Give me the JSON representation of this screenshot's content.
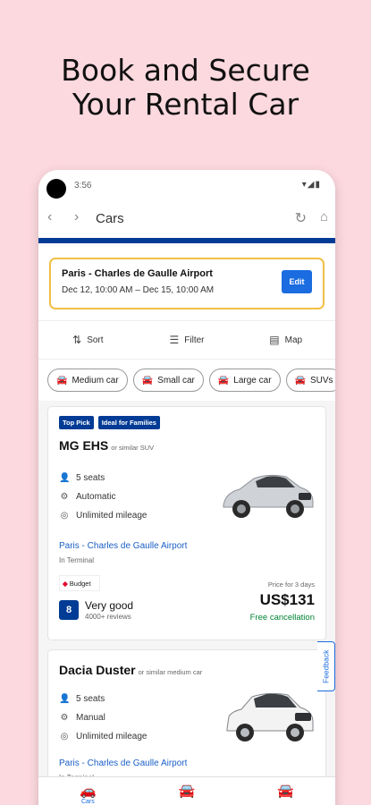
{
  "headline": {
    "line1": "Book and Secure",
    "line2": "Your Rental Car"
  },
  "status_bar": {
    "time": "3:56",
    "icons": "▾◢▮"
  },
  "nav": {
    "back": "‹",
    "forward": "›",
    "title": "Cars",
    "reload": "↻",
    "home": "⌂"
  },
  "search": {
    "location": "Paris - Charles de Gaulle Airport",
    "dates": "Dec 12, 10:00 AM   –   Dec 15, 10:00 AM",
    "edit_label": "Edit"
  },
  "toolbar": {
    "sort": "Sort",
    "filter": "Filter",
    "map": "Map"
  },
  "chips": [
    "Medium car",
    "Small car",
    "Large car",
    "SUVs"
  ],
  "cars": [
    {
      "badges": [
        "Top Pick",
        "Ideal for Families"
      ],
      "name": "MG EHS",
      "similar": "or similar SUV",
      "specs": [
        "5 seats",
        "Automatic",
        "Unlimited mileage"
      ],
      "pickup": "Paris - Charles de Gaulle Airport",
      "terminal": "In Terminal",
      "supplier": "Budget",
      "score": "8",
      "rating_label": "Very good",
      "reviews": "4000+ reviews",
      "price_for": "Price for 3 days",
      "price": "US$131",
      "free_cancel": "Free cancellation"
    },
    {
      "name": "Dacia Duster",
      "similar": "or similar medium car",
      "specs": [
        "5 seats",
        "Manual",
        "Unlimited mileage"
      ],
      "pickup": "Paris - Charles de Gaulle Airport",
      "terminal": "In Terminal"
    }
  ],
  "feedback_label": "Feedback",
  "bottom_nav": {
    "cars_label": "Cars"
  },
  "colors": {
    "accent": "#1a6ce0",
    "brand": "#003b95",
    "background": "#fcd9df",
    "highlight": "#f2bf46"
  }
}
